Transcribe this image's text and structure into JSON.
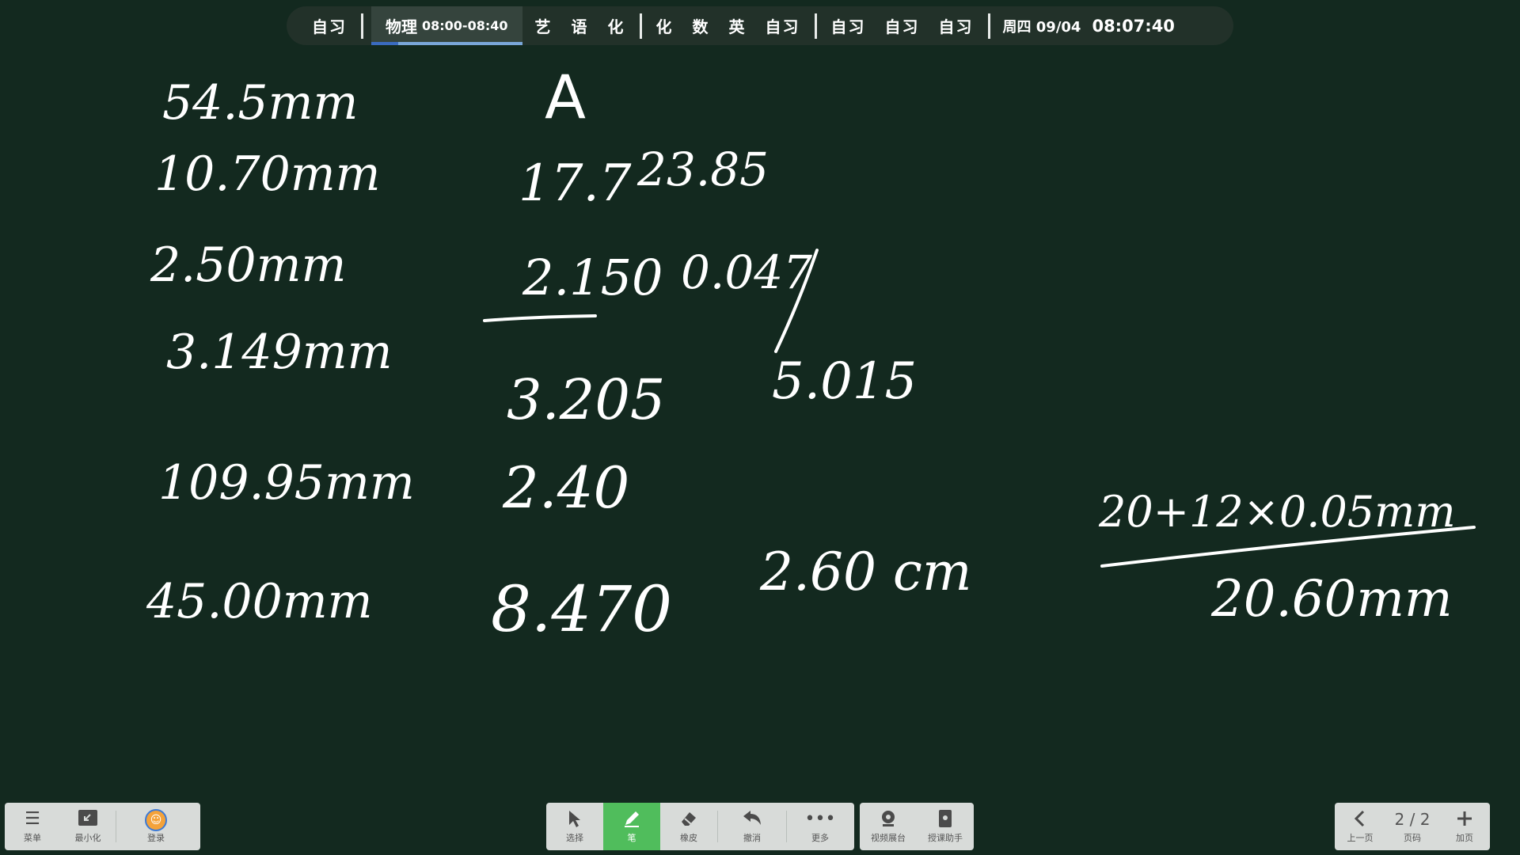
{
  "schedule": {
    "items_before": [
      "自习"
    ],
    "active": {
      "subject": "物理",
      "time": "08:00-08:40",
      "progress": 0.18
    },
    "group_a": [
      "艺",
      "语",
      "化"
    ],
    "group_b": [
      "化",
      "数",
      "英",
      "自习"
    ],
    "group_c": [
      "自习",
      "自习",
      "自习"
    ],
    "date": "周四 09/04",
    "clock": "08:07:40"
  },
  "board": {
    "col1": [
      "54.5mm",
      "10.70mm",
      "2.50mm",
      "3.149mm",
      "109.95mm",
      "45.00mm"
    ],
    "col2_header": "A",
    "col2": [
      "17.7",
      "2.150",
      "3.205",
      "2.40",
      "8.470"
    ],
    "col3": [
      "23.85",
      "0.047",
      "5.015",
      "2.60 cm"
    ],
    "calc_top": "20+12×0.05mm",
    "calc_bottom": "20.60mm"
  },
  "toolbar_left": {
    "menu": "菜单",
    "minimize": "最小化",
    "login": "登录"
  },
  "toolbar_center": {
    "select": "选择",
    "pen": "笔",
    "eraser": "橡皮",
    "undo": "撤消",
    "more": "更多",
    "video": "视频展台",
    "assistant": "授课助手"
  },
  "toolbar_right": {
    "prev": "上一页",
    "page_indicator": "2 / 2",
    "page_label": "页码",
    "add": "加页"
  },
  "icons": {
    "menu": "hamburger-icon",
    "minimize": "minimize-icon",
    "login": "avatar-icon",
    "select": "cursor-icon",
    "pen": "pen-icon",
    "eraser": "eraser-icon",
    "undo": "undo-icon",
    "more": "more-icon",
    "video": "camera-icon",
    "assistant": "tablet-icon",
    "prev": "chevron-left-icon",
    "add": "plus-icon"
  },
  "colors": {
    "board": "#13291f",
    "pen_active": "#50bd5c",
    "progress": "#3a6bbf"
  }
}
